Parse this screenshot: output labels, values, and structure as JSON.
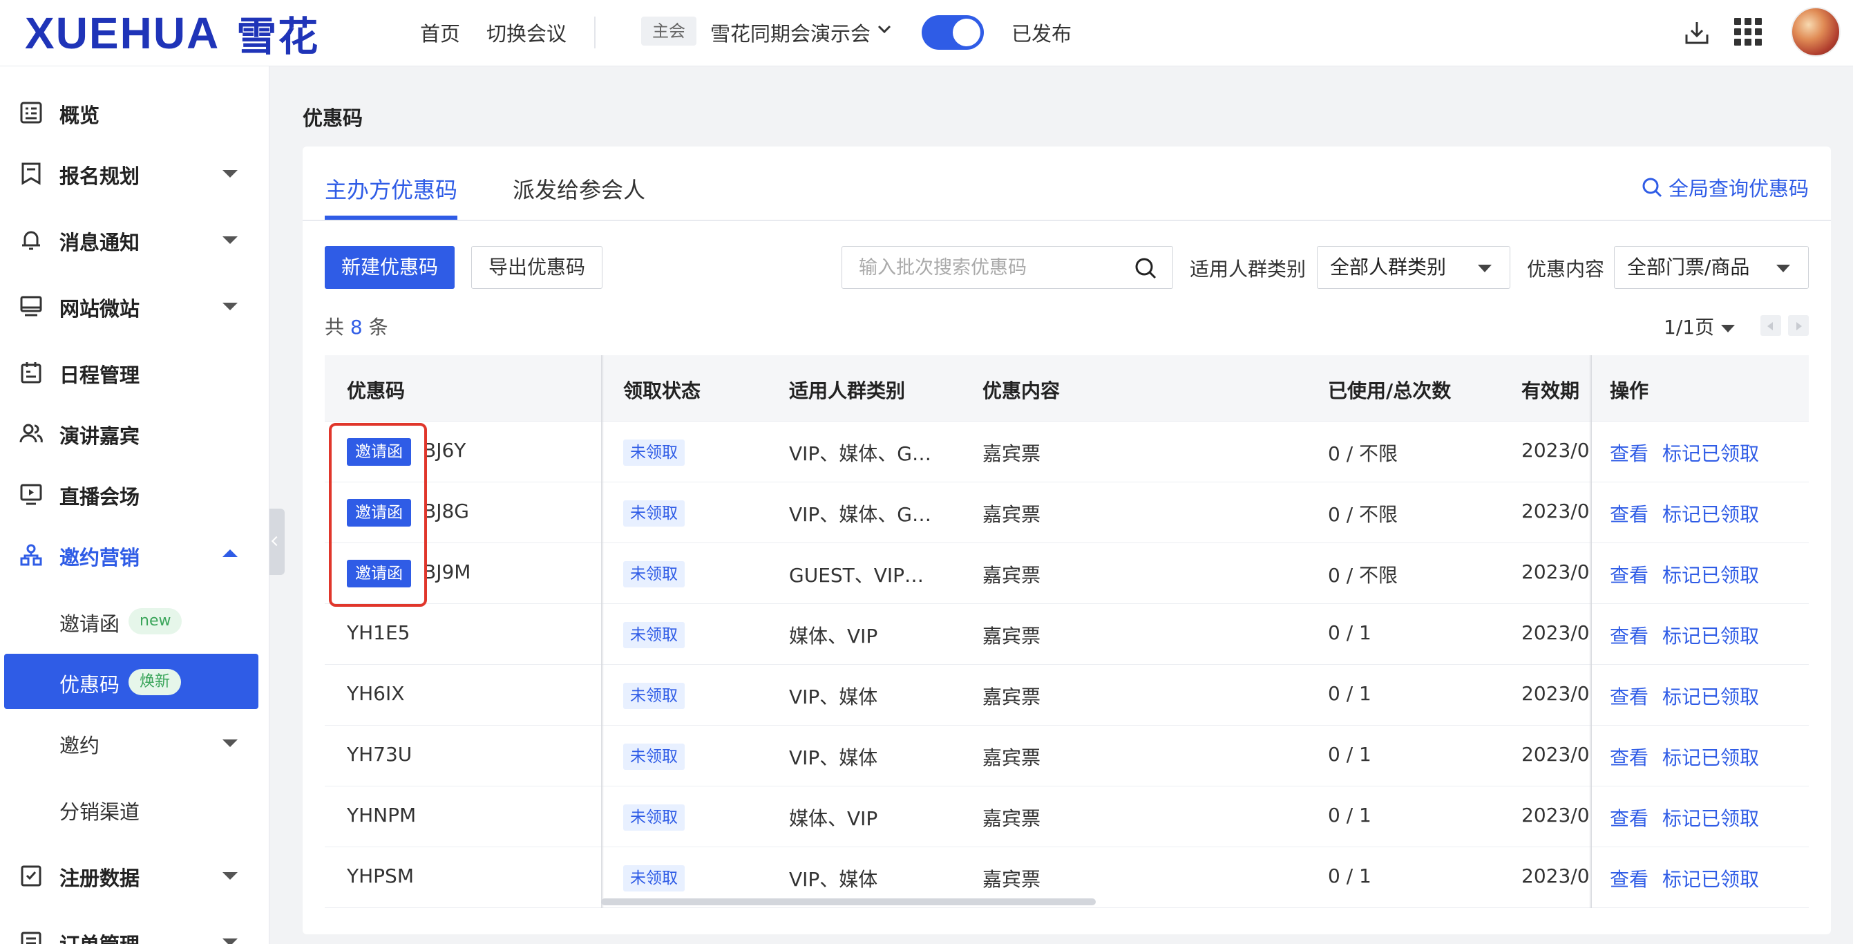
{
  "header": {
    "logo_en": "XUEHUA",
    "logo_cn": "雪花",
    "nav": [
      "首页",
      "切换会议"
    ],
    "main_tag": "主会",
    "meeting_name": "雪花同期会演示会",
    "publish_toggle_on": true,
    "publish_status": "已发布"
  },
  "sidebar": {
    "items": [
      {
        "label": "概览",
        "icon": "overview-icon",
        "caret": "none"
      },
      {
        "label": "报名规划",
        "icon": "registration-plan-icon",
        "caret": "down"
      },
      {
        "label": "消息通知",
        "icon": "bell-icon",
        "caret": "down"
      },
      {
        "label": "网站微站",
        "icon": "monitor-icon",
        "caret": "down"
      },
      {
        "label": "日程管理",
        "icon": "calendar-icon",
        "caret": "none"
      },
      {
        "label": "演讲嘉宾",
        "icon": "speakers-icon",
        "caret": "none"
      },
      {
        "label": "直播会场",
        "icon": "live-icon",
        "caret": "none"
      },
      {
        "label": "邀约营销",
        "icon": "network-icon",
        "caret": "up"
      },
      {
        "label": "邀请函",
        "badge": "new"
      },
      {
        "label": "优惠码",
        "badge": "焕新"
      },
      {
        "label": "邀约",
        "caret": "down"
      },
      {
        "label": "分销渠道"
      },
      {
        "label": "注册数据",
        "icon": "checklist-icon",
        "caret": "down"
      },
      {
        "label": "订单管理",
        "icon": "order-icon",
        "caret": "down"
      }
    ]
  },
  "page": {
    "title": "优惠码",
    "tabs": [
      "主办方优惠码",
      "派发给参会人"
    ],
    "global_search": "全局查询优惠码",
    "new_button": "新建优惠码",
    "export_button": "导出优惠码",
    "search_placeholder": "输入批次搜索优惠码",
    "filter1_label": "适用人群类别",
    "filter1_value": "全部人群类别",
    "filter2_label": "优惠内容",
    "filter2_value": "全部门票/商品",
    "total_prefix": "共",
    "total_count": "8",
    "total_suffix": "条",
    "pager": "1/1页"
  },
  "table": {
    "columns": [
      "优惠码",
      "领取状态",
      "适用人群类别",
      "优惠内容",
      "已使用/总次数",
      "有效期",
      "操作"
    ],
    "rows": [
      {
        "tag": "邀请函",
        "code": "BJ6Y",
        "status": "未领取",
        "groups": "VIP、媒体、G…",
        "content": "嘉宾票",
        "usage": "0 / 不限",
        "validity": "2023/0",
        "view": "查看",
        "mark": "标记已领取"
      },
      {
        "tag": "邀请函",
        "code": "BJ8G",
        "status": "未领取",
        "groups": "VIP、媒体、G…",
        "content": "嘉宾票",
        "usage": "0 / 不限",
        "validity": "2023/0",
        "view": "查看",
        "mark": "标记已领取"
      },
      {
        "tag": "邀请函",
        "code": "BJ9M",
        "status": "未领取",
        "groups": "GUEST、VIP…",
        "content": "嘉宾票",
        "usage": "0 / 不限",
        "validity": "2023/0",
        "view": "查看",
        "mark": "标记已领取"
      },
      {
        "tag": "",
        "code": "YH1E5",
        "status": "未领取",
        "groups": "媒体、VIP",
        "content": "嘉宾票",
        "usage": "0 / 1",
        "validity": "2023/0",
        "view": "查看",
        "mark": "标记已领取"
      },
      {
        "tag": "",
        "code": "YH6IX",
        "status": "未领取",
        "groups": "VIP、媒体",
        "content": "嘉宾票",
        "usage": "0 / 1",
        "validity": "2023/0",
        "view": "查看",
        "mark": "标记已领取"
      },
      {
        "tag": "",
        "code": "YH73U",
        "status": "未领取",
        "groups": "VIP、媒体",
        "content": "嘉宾票",
        "usage": "0 / 1",
        "validity": "2023/0",
        "view": "查看",
        "mark": "标记已领取"
      },
      {
        "tag": "",
        "code": "YHNPM",
        "status": "未领取",
        "groups": "媒体、VIP",
        "content": "嘉宾票",
        "usage": "0 / 1",
        "validity": "2023/0",
        "view": "查看",
        "mark": "标记已领取"
      },
      {
        "tag": "",
        "code": "YHPSM",
        "status": "未领取",
        "groups": "VIP、媒体",
        "content": "嘉宾票",
        "usage": "0 / 1",
        "validity": "2023/0",
        "view": "查看",
        "mark": "标记已领取"
      }
    ]
  },
  "colors": {
    "primary": "#2f5ce6",
    "logo": "#1f34b8",
    "highlight": "#e0362b",
    "badge_green": "#3aa55a"
  }
}
